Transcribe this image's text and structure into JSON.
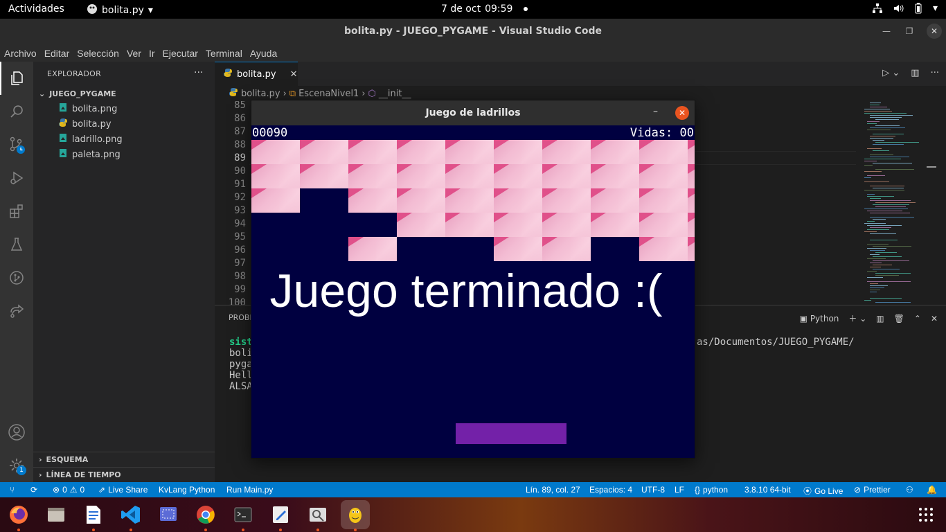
{
  "topbar": {
    "activities": "Actividades",
    "app_name": "bolita.py",
    "clock_date": "7 de oct",
    "clock_time": "09:59"
  },
  "window": {
    "title": "bolita.py - JUEGO_PYGAME - Visual Studio Code"
  },
  "menubar": {
    "items": [
      "Archivo",
      "Editar",
      "Selección",
      "Ver",
      "Ir",
      "Ejecutar",
      "Terminal",
      "Ayuda"
    ]
  },
  "activitybar": {
    "settings_badge": "1"
  },
  "sidebar": {
    "header": "EXPLORADOR",
    "folder": "JUEGO_PYGAME",
    "files": [
      "bolita.png",
      "bolita.py",
      "ladrillo.png",
      "paleta.png"
    ],
    "outline": "ESQUEMA",
    "timeline": "LÍNEA DE TIEMPO"
  },
  "editor": {
    "tab_label": "bolita.py",
    "breadcrumbs": [
      "bolita.py",
      "EscenaNivel1",
      "__init__"
    ],
    "line_numbers": [
      "85",
      "86",
      "87",
      "88",
      "89",
      "90",
      "91",
      "92",
      "93",
      "94",
      "95",
      "96",
      "97",
      "98",
      "99",
      "100"
    ],
    "current_line": "89"
  },
  "panel": {
    "title": "PROBL",
    "terminal_kind": "Python",
    "lines": [
      "sist",
      "boli",
      "pyga",
      "Hell",
      "ALSA"
    ],
    "path_fragment": "as/Documentos/JUEGO_PYGAME/"
  },
  "statusbar": {
    "errors": "0",
    "warnings": "0",
    "live_share": "Live Share",
    "kvlang": "KvLang Python",
    "run_main": "Run Main.py",
    "position": "Lín. 89, col. 27",
    "spaces": "Espacios: 4",
    "encoding": "UTF-8",
    "eol": "LF",
    "language": "python",
    "interpreter": "3.8.10 64-bit",
    "go_live": "Go Live",
    "prettier": "Prettier"
  },
  "game": {
    "window_title": "Juego de ladrillos",
    "score": "00090",
    "lives": "Vidas: 00",
    "message": "Juego terminado :(",
    "brick_rows": [
      [
        1,
        1,
        1,
        1,
        1,
        1,
        1,
        1,
        1,
        1
      ],
      [
        1,
        1,
        1,
        1,
        1,
        1,
        1,
        1,
        1,
        1
      ],
      [
        1,
        0,
        1,
        1,
        1,
        1,
        1,
        1,
        1,
        1
      ],
      [
        0,
        0,
        0,
        1,
        1,
        1,
        1,
        1,
        1,
        1
      ],
      [
        0,
        0,
        1,
        0,
        0,
        1,
        1,
        0,
        1,
        1
      ]
    ],
    "colors": {
      "background": "#000040",
      "paddle": "#7321a8",
      "brick": "#f3bcd3"
    }
  },
  "dock": {
    "apps": [
      "firefox-icon",
      "files-icon",
      "writer-icon",
      "vscode-icon",
      "screenshot-icon",
      "chrome-icon",
      "terminal-icon",
      "text-editor-icon",
      "image-viewer-icon",
      "pygame-icon"
    ]
  }
}
